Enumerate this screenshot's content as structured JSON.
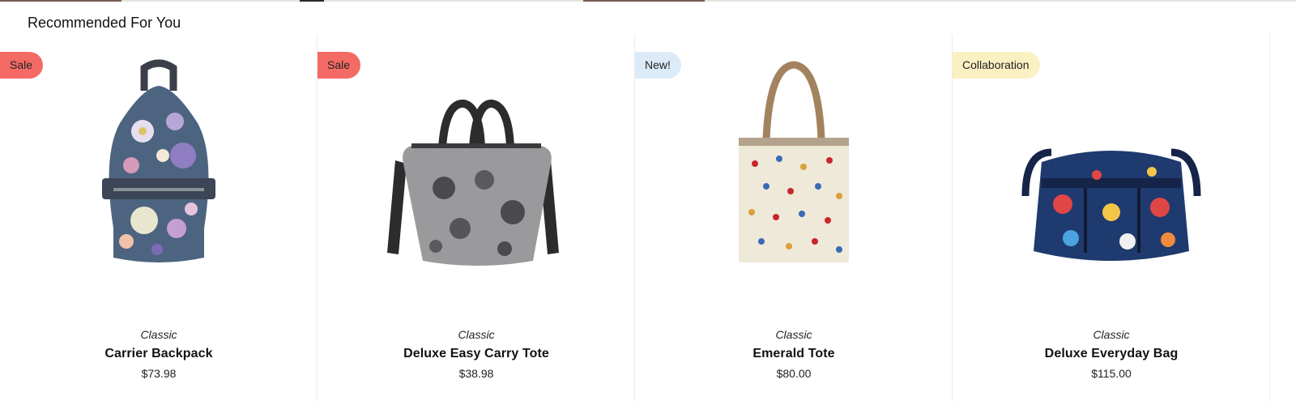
{
  "section": {
    "title": "Recommended For You"
  },
  "products": [
    {
      "badge": "Sale",
      "badge_type": "sale",
      "collection": "Classic",
      "name": "Carrier Backpack",
      "price": "$73.98",
      "image": "floral-backpack-image"
    },
    {
      "badge": "Sale",
      "badge_type": "sale",
      "collection": "Classic",
      "name": "Deluxe Easy Carry Tote",
      "price": "$38.98",
      "image": "gray-plaid-floral-tote-image"
    },
    {
      "badge": "New!",
      "badge_type": "new",
      "collection": "Classic",
      "name": "Emerald Tote",
      "price": "$80.00",
      "image": "cream-flower-print-tote-image"
    },
    {
      "badge": "Collaboration",
      "badge_type": "collab",
      "collection": "Classic",
      "name": "Deluxe Everyday Bag",
      "price": "$115.00",
      "image": "navy-patch-print-bag-image"
    }
  ],
  "colors": {
    "sale_badge": "#f46a65",
    "new_badge": "#dcebf8",
    "collab_badge": "#fbf0c1",
    "divider": "#ececec"
  }
}
